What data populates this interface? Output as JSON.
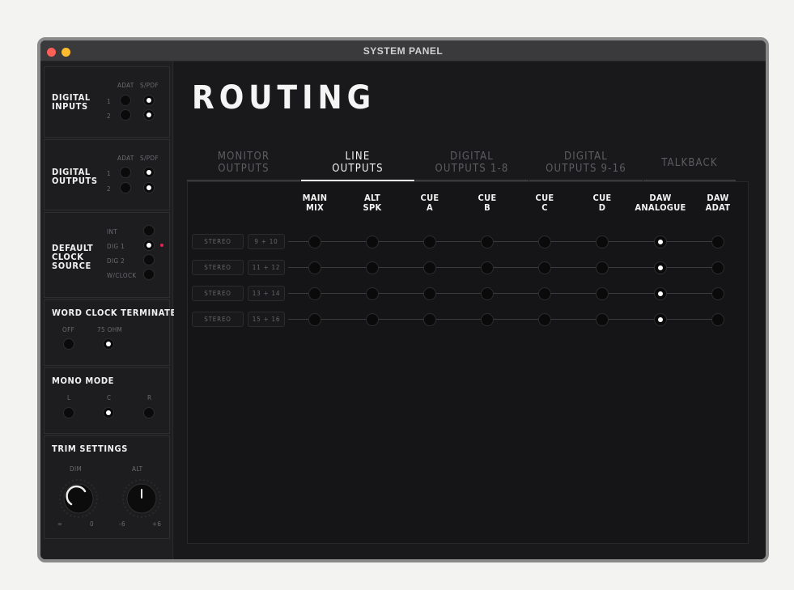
{
  "window": {
    "title": "SYSTEM PANEL"
  },
  "sidebar": {
    "digital_inputs": {
      "title": "DIGITAL\nINPUTS",
      "col_adat": "ADAT",
      "col_spdif": "S/PDF",
      "row1": "1",
      "row2": "2",
      "selected": [
        "spdif",
        "spdif"
      ]
    },
    "digital_outputs": {
      "title": "DIGITAL\nOUTPUTS",
      "col_adat": "ADAT",
      "col_spdif": "S/PDF",
      "row1": "1",
      "row2": "2",
      "selected": [
        "spdif",
        "spdif"
      ]
    },
    "clock_source": {
      "title": "DEFAULT\nCLOCK\nSOURCE",
      "options": [
        "INT",
        "DIG 1",
        "DIG 2",
        "W/CLOCK"
      ],
      "selected": "DIG 1"
    },
    "word_clock": {
      "title": "WORD CLOCK TERMINATE",
      "options": [
        "OFF",
        "75 OHM"
      ],
      "selected": "75 OHM"
    },
    "mono_mode": {
      "title": "MONO MODE",
      "options": [
        "L",
        "C",
        "R"
      ],
      "selected": "C"
    },
    "trim": {
      "title": "TRIM SETTINGS",
      "dim": {
        "label": "DIM",
        "min": "∞",
        "max": "0"
      },
      "alt": {
        "label": "ALT",
        "min": "-6",
        "max": "+6"
      }
    }
  },
  "main": {
    "title": "ROUTING",
    "tabs": [
      {
        "line1": "MONITOR",
        "line2": "OUTPUTS",
        "active": false
      },
      {
        "line1": "LINE",
        "line2": "OUTPUTS",
        "active": true
      },
      {
        "line1": "DIGITAL",
        "line2": "OUTPUTS 1-8",
        "active": false
      },
      {
        "line1": "DIGITAL",
        "line2": "OUTPUTS 9-16",
        "active": false
      },
      {
        "line1": "TALKBACK",
        "line2": "",
        "active": false
      }
    ],
    "columns": [
      {
        "line1": "MAIN",
        "line2": "MIX"
      },
      {
        "line1": "ALT",
        "line2": "SPK"
      },
      {
        "line1": "CUE",
        "line2": "A"
      },
      {
        "line1": "CUE",
        "line2": "B"
      },
      {
        "line1": "CUE",
        "line2": "C"
      },
      {
        "line1": "CUE",
        "line2": "D"
      },
      {
        "line1": "DAW",
        "line2": "ANALOGUE"
      },
      {
        "line1": "DAW",
        "line2": "ADAT"
      }
    ],
    "rows": [
      {
        "mode": "STEREO",
        "channels": "9 + 10",
        "selected_col": 6
      },
      {
        "mode": "STEREO",
        "channels": "11 + 12",
        "selected_col": 6
      },
      {
        "mode": "STEREO",
        "channels": "13 + 14",
        "selected_col": 6
      },
      {
        "mode": "STEREO",
        "channels": "15 + 16",
        "selected_col": 6
      }
    ]
  },
  "colors": {
    "accent_red": "#e8224f",
    "on_white": "#ffffff",
    "background": "#19191b"
  }
}
